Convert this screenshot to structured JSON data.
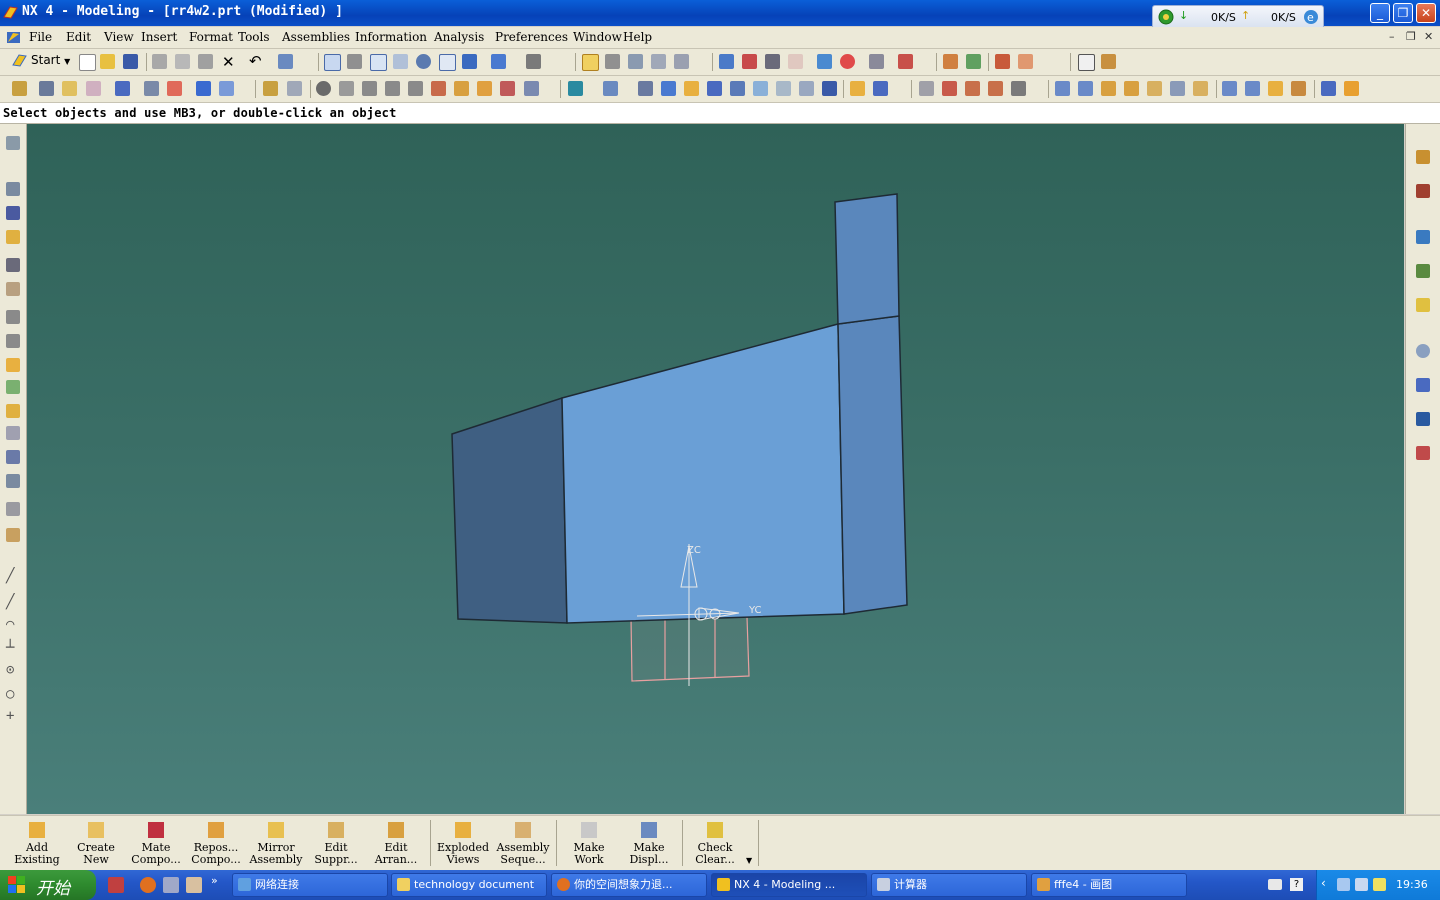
{
  "window": {
    "title": "NX 4 - Modeling - [rr4w2.prt (Modified) ]",
    "net_down": "0K/S",
    "net_up": "0K/S"
  },
  "menu": [
    "File",
    "Edit",
    "View",
    "Insert",
    "Format",
    "Tools",
    "Assemblies",
    "Information",
    "Analysis",
    "Preferences",
    "Window",
    "Help"
  ],
  "toolbar": {
    "start_label": "Start"
  },
  "cue_line": "Select objects and use MB3, or double-click an object",
  "viewport": {
    "axis_z": "ZC",
    "axis_y": "YC",
    "model_color": "#6a9fd6",
    "bg_color": "#3a6e66"
  },
  "assembly_toolbar": [
    {
      "line1": "Add",
      "line2": "Existing"
    },
    {
      "line1": "Create",
      "line2": "New"
    },
    {
      "line1": "Mate",
      "line2": "Compo..."
    },
    {
      "line1": "Repos...",
      "line2": "Compo..."
    },
    {
      "line1": "Mirror",
      "line2": "Assembly"
    },
    {
      "line1": "Edit",
      "line2": "Suppr..."
    },
    {
      "line1": "Edit",
      "line2": "Arran..."
    },
    {
      "line1": "Exploded",
      "line2": "Views"
    },
    {
      "line1": "Assembly",
      "line2": "Seque..."
    },
    {
      "line1": "Make",
      "line2": "Work"
    },
    {
      "line1": "Make",
      "line2": "Displ..."
    },
    {
      "line1": "Check",
      "line2": "Clear..."
    }
  ],
  "taskbar": {
    "start_label": "开始",
    "tasks": [
      "网络连接",
      "technology document",
      "你的空间想象力退...",
      "NX 4 - Modeling ...",
      "计算器",
      "fffe4 - 画图"
    ],
    "clock": "19:36"
  }
}
